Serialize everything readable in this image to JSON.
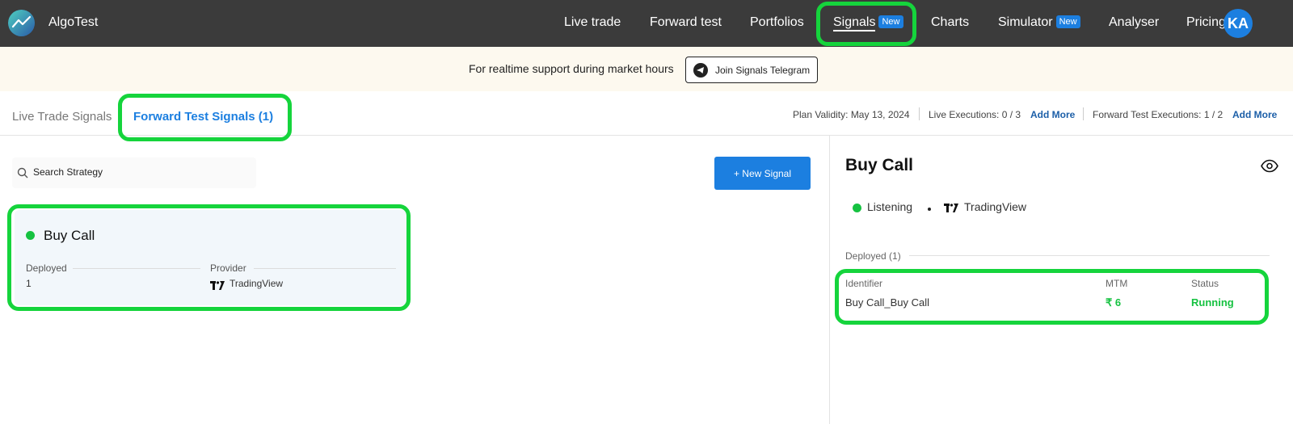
{
  "nav": {
    "brand": "AlgoTest",
    "items": [
      "Live trade",
      "Forward test",
      "Portfolios",
      "Signals",
      "Charts",
      "Simulator",
      "Analyser",
      "Pricing"
    ],
    "signals_badge": "New",
    "simulator_badge": "New",
    "avatar_initials": "KA"
  },
  "banner": {
    "text": "For realtime support during market hours",
    "telegram_button": "Join Signals Telegram"
  },
  "tabs": {
    "live": "Live Trade Signals",
    "forward": "Forward Test Signals (1)"
  },
  "plan": {
    "validity": "Plan Validity: May 13, 2024",
    "live_executions": "Live Executions: 0 / 3",
    "add_more_live": "Add More",
    "forward_executions": "Forward Test Executions: 1 / 2",
    "add_more_forward": "Add More"
  },
  "search": {
    "placeholder": "Search Strategy"
  },
  "new_signal_button": "+ New Signal",
  "signal_card": {
    "title": "Buy Call",
    "deployed_label": "Deployed",
    "deployed_value": "1",
    "provider_label": "Provider",
    "provider_value": "TradingView",
    "status_color": "#16c241"
  },
  "detail": {
    "title": "Buy Call",
    "status": "Listening",
    "provider": "TradingView",
    "deployed_heading": "Deployed (1)",
    "table": {
      "headers": [
        "Identifier",
        "MTM",
        "Status"
      ],
      "rows": [
        {
          "identifier": "Buy Call_Buy Call",
          "mtm": "₹ 6",
          "status": "Running"
        }
      ]
    }
  },
  "colors": {
    "accent": "#1c7fe0",
    "highlight": "#15d43c",
    "positive": "#16c241",
    "topbar": "#3b3b3b"
  }
}
